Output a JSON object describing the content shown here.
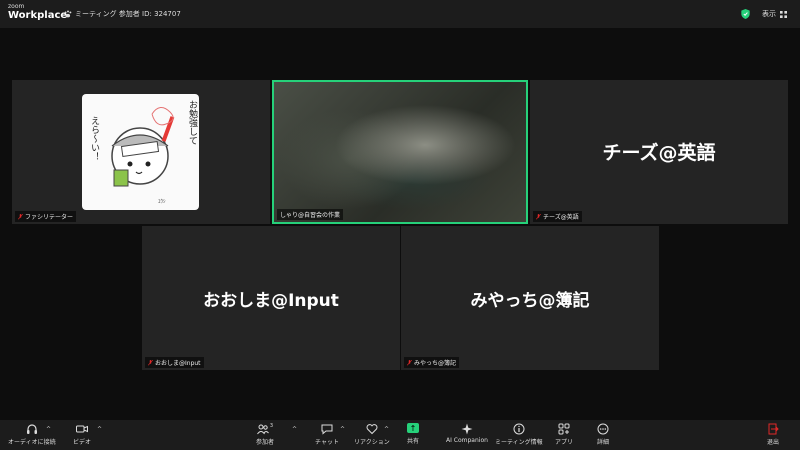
{
  "topbar": {
    "logo_line1": "zoom",
    "logo_line2": "Workplace",
    "meeting_label": "ミーティング 参加者 ID: 324707",
    "view_label": "表示"
  },
  "tiles": [
    {
      "name": "ファシリテーター",
      "big_text": ""
    },
    {
      "name": "しゃり@自習会の作業",
      "big_text": ""
    },
    {
      "name": "チーズ@英語",
      "big_text": "チーズ@英語"
    },
    {
      "name": "おおしま@Input",
      "big_text": "おおしま@Input"
    },
    {
      "name": "みやっち@簿記",
      "big_text": "みやっち@簿記"
    }
  ],
  "avatar_text": {
    "vertical1": "お勉強して",
    "vertical2": "えら〜い！",
    "signature": "ﾕｳｼ"
  },
  "toolbar": {
    "audio": "オーディオに接続",
    "video": "ビデオ",
    "participants": "参加者",
    "participants_count": "3",
    "chat": "チャット",
    "reactions": "リアクション",
    "share": "共有",
    "ai": "AI Companion",
    "meeting_info": "ミーティング情報",
    "apps": "アプリ",
    "more": "詳細",
    "leave": "退出"
  },
  "colors": {
    "accent_green": "#26d17a",
    "leave_red": "#e02828",
    "tile_bg": "#242424"
  }
}
